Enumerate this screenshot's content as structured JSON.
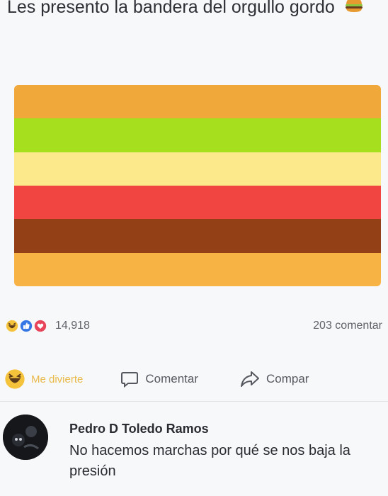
{
  "post": {
    "text": "Les presento la bandera del orgullo gordo",
    "emoji": "hamburger-icon"
  },
  "flag": {
    "stripes": [
      "#f0a83a",
      "#a6df1d",
      "#fbe98c",
      "#f04540",
      "#944016",
      "#f7b444"
    ]
  },
  "reactions": {
    "icons": [
      "haha-icon",
      "like-icon",
      "love-icon"
    ],
    "count": "14,918",
    "comments": "203 comentar"
  },
  "actions": {
    "haha_label": "Me divierte",
    "comment_label": "Comentar",
    "share_label": "Compar"
  },
  "comment": {
    "author": "Pedro D Toledo Ramos",
    "text": "No hacemos marchas por qué se nos baja la presión"
  }
}
